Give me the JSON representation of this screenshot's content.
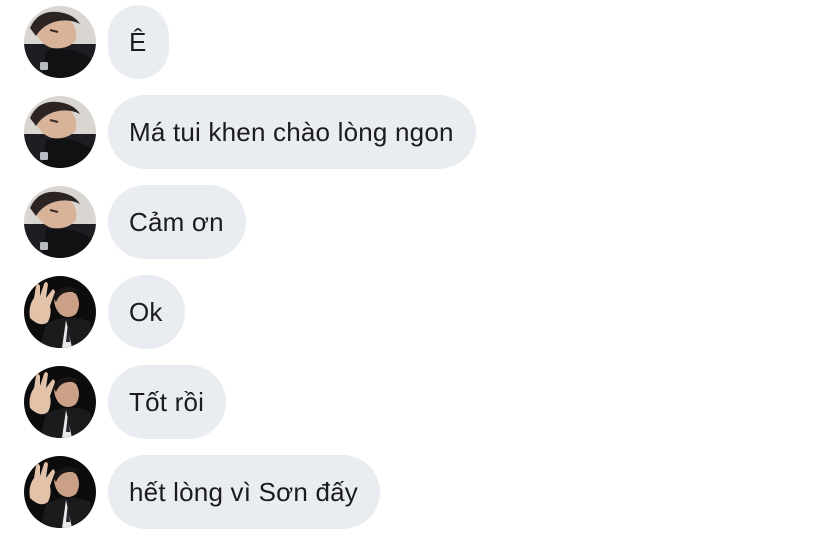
{
  "conversation": {
    "messages": [
      {
        "text": "Ê",
        "avatar": "user-a-avatar"
      },
      {
        "text": "Má tui khen chào lòng ngon",
        "avatar": "user-a-avatar"
      },
      {
        "text": "Cảm ơn",
        "avatar": "user-a-avatar"
      },
      {
        "text": "Ok",
        "avatar": "user-b-avatar"
      },
      {
        "text": "Tốt rồi",
        "avatar": "user-b-avatar"
      },
      {
        "text": "hết lòng vì Sơn đấy",
        "avatar": "user-b-avatar"
      }
    ]
  },
  "colors": {
    "background": "#ffffff",
    "bubble": "#e9ecf1",
    "text": "#1c1c1e"
  }
}
